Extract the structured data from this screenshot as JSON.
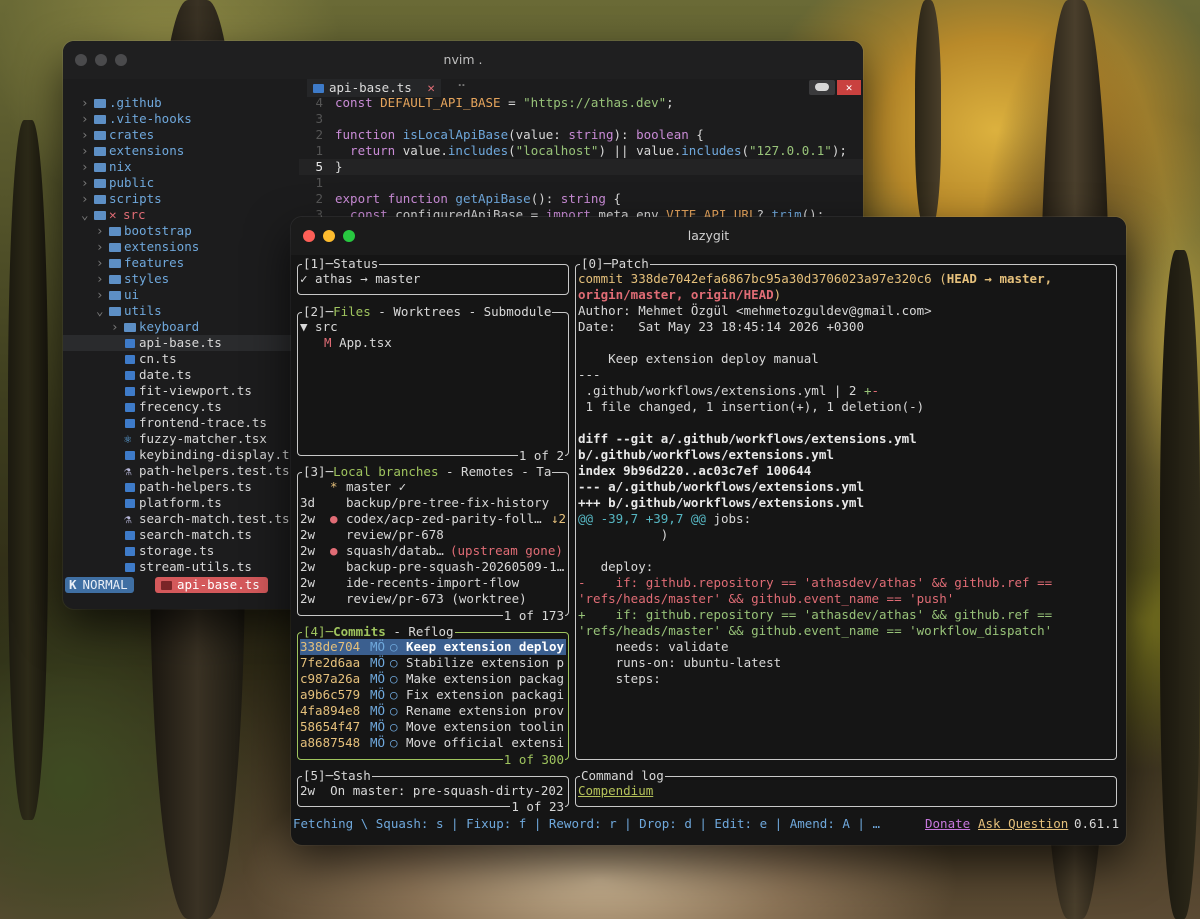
{
  "colors": {
    "accent": "#9fc45e",
    "blue": "#6fa8dc",
    "red": "#e06c75",
    "orange": "#e08a4c",
    "yellow": "#e5c07b"
  },
  "nvim": {
    "title": "nvim .",
    "tab": {
      "icon": "ts-file-icon",
      "name": "api-base.ts",
      "close": "✕"
    },
    "dots": "⠤",
    "tree": [
      {
        "chev": "›",
        "name": ".github"
      },
      {
        "chev": "›",
        "name": ".vite-hooks"
      },
      {
        "chev": "›",
        "name": "crates"
      },
      {
        "chev": "›",
        "name": "extensions"
      },
      {
        "chev": "›",
        "name": "nix"
      },
      {
        "chev": "›",
        "name": "public"
      },
      {
        "chev": "›",
        "name": "scripts"
      },
      {
        "chev": "⌄",
        "mark": "✕",
        "name": "src"
      },
      {
        "chev": "›",
        "name": "bootstrap"
      },
      {
        "chev": "›",
        "name": "extensions"
      },
      {
        "chev": "›",
        "name": "features"
      },
      {
        "chev": "›",
        "name": "styles"
      },
      {
        "chev": "›",
        "name": "ui"
      },
      {
        "chev": "⌄",
        "name": "utils"
      },
      {
        "chev": "›",
        "name": "keyboard"
      },
      {
        "name": "api-base.ts"
      },
      {
        "name": "cn.ts"
      },
      {
        "name": "date.ts"
      },
      {
        "name": "fit-viewport.ts"
      },
      {
        "name": "frecency.ts"
      },
      {
        "name": "frontend-trace.ts"
      },
      {
        "name": "fuzzy-matcher.tsx"
      },
      {
        "name": "keybinding-display.t"
      },
      {
        "name": "path-helpers.test.ts"
      },
      {
        "name": "path-helpers.ts"
      },
      {
        "name": "platform.ts"
      },
      {
        "name": "search-match.test.ts"
      },
      {
        "name": "search-match.ts"
      },
      {
        "name": "storage.ts"
      },
      {
        "name": "stream-utils.ts"
      }
    ],
    "code": [
      {
        "ln": "4",
        "parts": [
          [
            "const ",
            "kw"
          ],
          [
            "DEFAULT_API_BASE",
            "cn"
          ],
          [
            " = ",
            "p"
          ],
          [
            "\"https://athas.dev\"",
            "str"
          ],
          [
            ";",
            "p"
          ]
        ]
      },
      {
        "ln": "3",
        "parts": []
      },
      {
        "ln": "2",
        "parts": [
          [
            "function ",
            "kw"
          ],
          [
            "isLocalApiBase",
            "fn"
          ],
          [
            "(",
            "p"
          ],
          [
            "value",
            "p"
          ],
          [
            ": ",
            "p"
          ],
          [
            "string",
            "kw"
          ],
          [
            "): ",
            "p"
          ],
          [
            "boolean",
            "kw"
          ],
          [
            " {",
            "p"
          ]
        ]
      },
      {
        "ln": "1",
        "parts": [
          [
            "  return ",
            "kw"
          ],
          [
            "value",
            "p"
          ],
          [
            ".",
            "p"
          ],
          [
            "includes",
            "fn"
          ],
          [
            "(",
            "p"
          ],
          [
            "\"localhost\"",
            "str"
          ],
          [
            ") || ",
            "p"
          ],
          [
            "value",
            "p"
          ],
          [
            ".",
            "p"
          ],
          [
            "includes",
            "fn"
          ],
          [
            "(",
            "p"
          ],
          [
            "\"127.0.0.1\"",
            "str"
          ],
          [
            ");",
            "p"
          ]
        ]
      },
      {
        "ln": "5",
        "parts": [
          [
            "}",
            "p"
          ]
        ]
      },
      {
        "ln": "1",
        "parts": []
      },
      {
        "ln": "2",
        "parts": [
          [
            "export ",
            "kw"
          ],
          [
            "function ",
            "kw"
          ],
          [
            "getApiBase",
            "fn"
          ],
          [
            "(): ",
            "p"
          ],
          [
            "string",
            "kw"
          ],
          [
            " {",
            "p"
          ]
        ]
      },
      {
        "ln": "3",
        "parts": [
          [
            "  const ",
            "kw"
          ],
          [
            "configuredApiBase",
            "p"
          ],
          [
            " = ",
            "p"
          ],
          [
            "import",
            "kw"
          ],
          [
            ".",
            "p"
          ],
          [
            "meta",
            "p"
          ],
          [
            ".",
            "p"
          ],
          [
            "env",
            "p"
          ],
          [
            ".",
            "p"
          ],
          [
            "VITE_API_URL",
            "cn"
          ],
          [
            "?.",
            "p"
          ],
          [
            "trim",
            "fn"
          ],
          [
            "();",
            "p"
          ]
        ]
      }
    ],
    "status": {
      "mode": "NORMAL",
      "file": "api-base.ts"
    }
  },
  "lazygit": {
    "title": "lazygit",
    "status": {
      "title": "[1]─Status",
      "text": "✓ athas → master"
    },
    "files": {
      "num": "[2]─",
      "tab1": "Files",
      "rest": " - Worktrees - Submodule",
      "dir": "▼ src",
      "mark": "M",
      "file": "App.tsx",
      "footer": "1 of 2"
    },
    "branches": {
      "num": "[3]─",
      "tab1": "Local branches",
      "rest": " - Remotes - Ta",
      "footer": "1 of 173",
      "items": [
        {
          "age": "",
          "bullet": "*",
          "name": "master ✓",
          "extra": ""
        },
        {
          "age": "3d",
          "bullet": "",
          "name": "backup/pre-tree-fix-history",
          "extra": ""
        },
        {
          "age": "2w",
          "bullet": "●",
          "name": "codex/acp-zed-parity-foll…",
          "extra": "↓2"
        },
        {
          "age": "2w",
          "bullet": "",
          "name": "review/pr-678",
          "extra": ""
        },
        {
          "age": "2w",
          "bullet": "●",
          "name": "squash/datab…",
          "extra": "(upstream gone)"
        },
        {
          "age": "2w",
          "bullet": "",
          "name": "backup-pre-squash-20260509-1…",
          "extra": ""
        },
        {
          "age": "2w",
          "bullet": "",
          "name": "ide-recents-import-flow",
          "extra": ""
        },
        {
          "age": "2w",
          "bullet": "",
          "name": "review/pr-673 (worktree)",
          "extra": ""
        }
      ]
    },
    "commits": {
      "num": "[4]─",
      "tab1": "Commits",
      "rest": " - Reflog",
      "footer": "1 of 300",
      "items": [
        {
          "sha": "338de704",
          "au": "MÖ",
          "msg": "Keep extension deploy"
        },
        {
          "sha": "7fe2d6aa",
          "au": "MÖ",
          "msg": "Stabilize extension p"
        },
        {
          "sha": "c987a26a",
          "au": "MÖ",
          "msg": "Make extension packag"
        },
        {
          "sha": "a9b6c579",
          "au": "MÖ",
          "msg": "Fix extension packagi"
        },
        {
          "sha": "4fa894e8",
          "au": "MÖ",
          "msg": "Rename extension prov"
        },
        {
          "sha": "58654f47",
          "au": "MÖ",
          "msg": "Move extension toolin"
        },
        {
          "sha": "a8687548",
          "au": "MÖ",
          "msg": "Move official extensi"
        }
      ]
    },
    "stash": {
      "title": "[5]─Stash",
      "age": "2w",
      "text": "On master: pre-squash-dirty-202",
      "footer": "1 of 23"
    },
    "patch": {
      "title": "[0]─Patch",
      "lines": [
        [
          [
            "commit 338de7042efa6867bc95a30d3706023a97e320c6 (",
            "y"
          ],
          [
            "HEAD → master,",
            "c"
          ]
        ],
        [
          [
            "origin/master, origin/HEAD",
            "r"
          ],
          [
            ")",
            "y"
          ]
        ],
        [
          [
            "Author: Mehmet Özgül <mehmetozguldev@gmail.com>",
            "w"
          ]
        ],
        [
          [
            "Date:   Sat May 23 18:45:14 2026 +0300",
            "w"
          ]
        ],
        [],
        [
          [
            "    Keep extension deploy manual",
            "w"
          ]
        ],
        [
          [
            "---",
            "w"
          ]
        ],
        [
          [
            " .github/workflows/extensions.yml | 2 ",
            "w"
          ],
          [
            "+",
            "g"
          ],
          [
            "-",
            "r"
          ]
        ],
        [
          [
            " 1 file changed, 1 insertion(+), 1 deletion(-)",
            "w"
          ]
        ],
        [],
        [
          [
            "diff --git a/.github/workflows/extensions.yml",
            "b"
          ]
        ],
        [
          [
            "b/.github/workflows/extensions.yml",
            "b"
          ]
        ],
        [
          [
            "index 9b96d220..ac03c7ef 100644",
            "b"
          ]
        ],
        [
          [
            "--- a/.github/workflows/extensions.yml",
            "b"
          ]
        ],
        [
          [
            "+++ b/.github/workflows/extensions.yml",
            "b"
          ]
        ],
        [
          [
            "@@ -39,7 +39,7 @@",
            "cy"
          ],
          [
            " jobs:",
            "w"
          ]
        ],
        [
          [
            "           )",
            "w"
          ]
        ],
        [],
        [
          [
            "   deploy:",
            "w"
          ]
        ],
        [
          [
            "-    if: github.repository == 'athasdev/athas' && github.ref ==",
            "r"
          ]
        ],
        [
          [
            "'refs/heads/master' && github.event_name == 'push'",
            "r"
          ]
        ],
        [
          [
            "+    if: github.repository == 'athasdev/athas' && github.ref ==",
            "g"
          ]
        ],
        [
          [
            "'refs/heads/master' && github.event_name == 'workflow_dispatch'",
            "g"
          ]
        ],
        [
          [
            "     needs: validate",
            "w"
          ]
        ],
        [
          [
            "     runs-on: ubuntu-latest",
            "w"
          ]
        ],
        [
          [
            "     steps:",
            "w"
          ]
        ]
      ]
    },
    "cmdlog": {
      "title": "Command log",
      "text": "Compendium"
    },
    "bottom": {
      "keys": "Fetching \\ Squash: s | Fixup: f | Reword: r | Drop: d | Edit: e | Amend: A | …",
      "donate": "Donate",
      "ask": "Ask Question",
      "version": "0.61.1"
    }
  }
}
